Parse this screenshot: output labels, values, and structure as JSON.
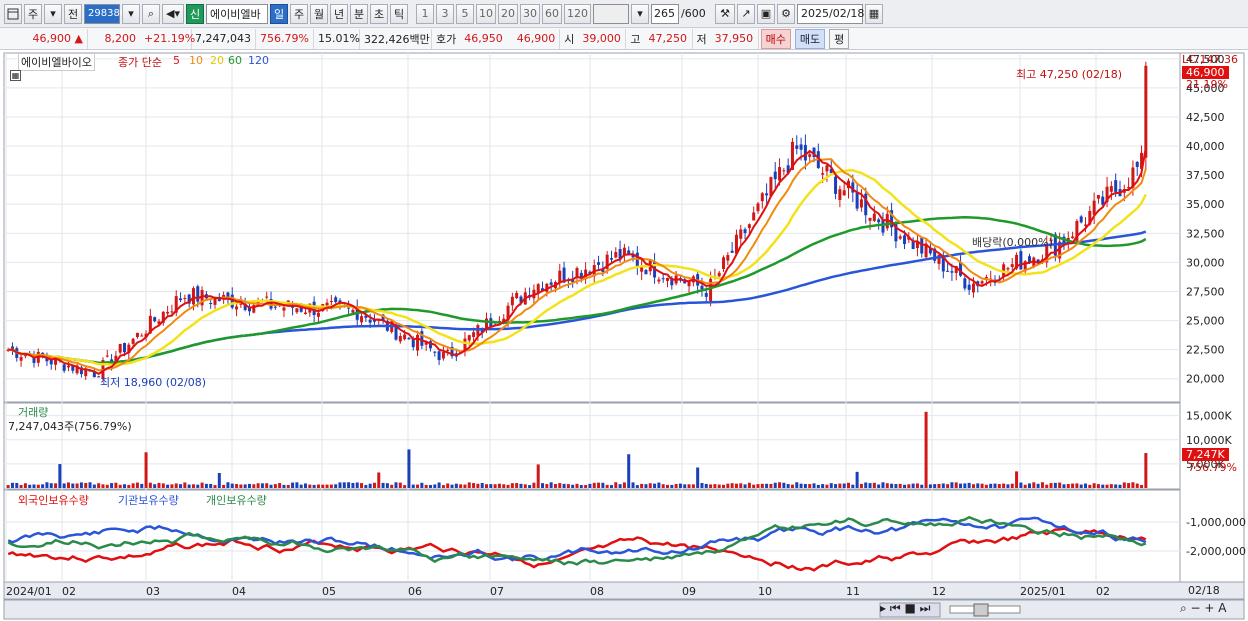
{
  "toolbar": {
    "icon_layout": "layout-icon",
    "btn_ju": "주",
    "btn_jeon": "전",
    "code": "298380",
    "name": "에이비엘바",
    "badge_new": "신",
    "periods": [
      "일",
      "주",
      "월",
      "년",
      "분",
      "초",
      "틱"
    ],
    "intervals": [
      "1",
      "3",
      "5",
      "10",
      "20",
      "30",
      "60",
      "120"
    ],
    "count": "265",
    "count_max": "/600",
    "date": "2025/02/18"
  },
  "infobar": {
    "price": "46,900",
    "change": "8,200",
    "change_pct": "+21.19%",
    "volume": "7,247,043",
    "volume_ratio": "756.79%",
    "turnover": "15.01%",
    "amount": "322,426백만",
    "ask_label": "호가",
    "ask": "46,950",
    "bid": "46,900",
    "open_label": "시",
    "open": "39,000",
    "high_label": "고",
    "high": "47,250",
    "low_label": "저",
    "low": "37,950",
    "buy": "매수",
    "sell": "매도",
    "eval": "평"
  },
  "price_panel": {
    "title": "에이비엘바이오",
    "ma_label": "종가 단순",
    "ma_periods": [
      "5",
      "10",
      "20",
      "60",
      "120"
    ],
    "lc": "LC:147.36",
    "last_price": "46,900",
    "last_pct": "21.19%",
    "high_note": "최고 47,250 (02/18)",
    "low_note": "최저 18,960 (02/08)",
    "dividend_note": "배당락(0.000%)",
    "y_ticks": [
      "47,500",
      "45,000",
      "42,500",
      "40,000",
      "37,500",
      "35,000",
      "32,500",
      "30,000",
      "27,500",
      "25,000",
      "22,500",
      "20,000"
    ]
  },
  "volume_panel": {
    "title": "거래량",
    "value": "7,247,043주(756.79%)",
    "y_ticks": [
      "15,000K",
      "10,000K",
      "5,000K"
    ],
    "last": "7,247K",
    "last_pct": "756.79%"
  },
  "holding_panel": {
    "legend": [
      "외국인보유수량",
      "기관보유수량",
      "개인보유수량"
    ],
    "y_ticks": [
      "-1,000,000",
      "-2,000,000"
    ]
  },
  "x_axis": {
    "labels": [
      "2024/01",
      "02",
      "03",
      "04",
      "05",
      "06",
      "07",
      "08",
      "09",
      "10",
      "11",
      "12",
      "2025/01",
      "02"
    ],
    "last_date": "02/18"
  },
  "colors": {
    "up": "#d01818",
    "down": "#1a3fb8",
    "ma5": "#e01010",
    "ma10": "#f08a10",
    "ma20": "#f2e21a",
    "ma60": "#1f9a2a",
    "ma120": "#2a55d8",
    "foreign": "#e01010",
    "inst": "#2a55d8",
    "indiv": "#2a8a4a"
  },
  "chart_data": {
    "type": "candlestick",
    "x_range": [
      "2024/01",
      "2025/02/18"
    ],
    "price_range": [
      18000,
      48000
    ],
    "monthly_close": [
      22500,
      20500,
      27200,
      26300,
      25800,
      21800,
      28000,
      30600,
      27600,
      39700,
      33500,
      28100,
      31600,
      38700
    ],
    "ma120_end": 32800,
    "ma60_end": 31300,
    "ma20_end": 36900,
    "last_bar": {
      "open": 39000,
      "high": 47250,
      "low": 37950,
      "close": 46900
    },
    "volume_last": 7247043
  }
}
